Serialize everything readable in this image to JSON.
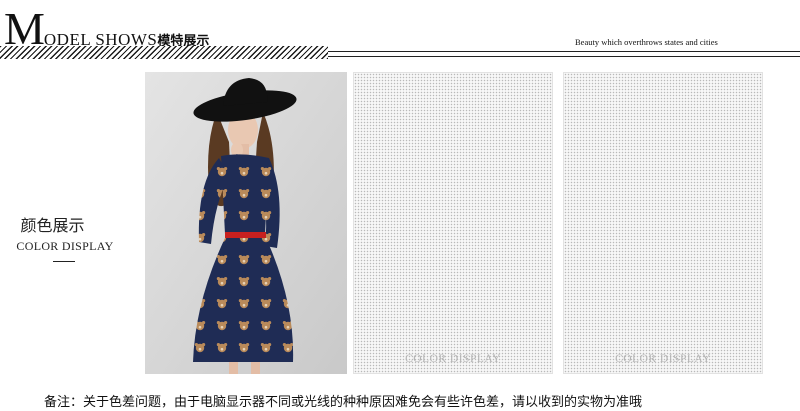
{
  "header": {
    "title_big": "M",
    "title_rest": "ODEL SHOWS",
    "title_cn": "模特展示",
    "tagline": "Beauty which overthrows states and cities"
  },
  "sidebar": {
    "label_cn": "颜色展示",
    "label_en": "COLOR DISPLAY"
  },
  "swatches": [
    {
      "label": "COLOR DISPLAY"
    },
    {
      "label": "COLOR DISPLAY"
    }
  ],
  "footer": {
    "note": "备注：关于色差问题，由于电脑显示器不同或光线的种种原因难免会有些许色差，请以收到的实物为准哦"
  },
  "colors": {
    "dress_navy": "#1f2c55",
    "belt_red": "#c8201f",
    "hat_black": "#111111",
    "background": "#ffffff"
  }
}
